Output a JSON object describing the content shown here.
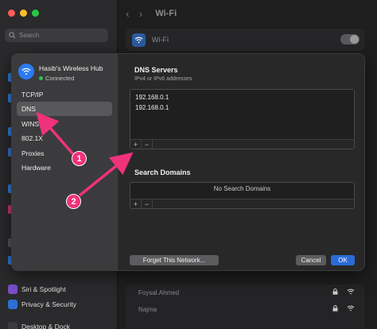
{
  "window": {
    "title": "Wi-Fi",
    "search_placeholder": "Search"
  },
  "sidebar": {
    "items": [
      {
        "label": "Siri & Spotlight",
        "icon": "siri-icon",
        "color": "#7a4ec9"
      },
      {
        "label": "Privacy & Security",
        "icon": "hand-icon",
        "color": "#2c6fd6"
      },
      {
        "label": "Desktop & Dock",
        "icon": "dock-icon",
        "color": "#3a3a3c"
      }
    ]
  },
  "wifi_card": {
    "label": "Wi-Fi"
  },
  "known_networks": [
    {
      "name": "Foysal.Ahmed"
    },
    {
      "name": "Najma"
    }
  ],
  "dialog": {
    "network_name": "Hasib's Wireless Hub",
    "network_status": "Connected",
    "nav_items": [
      {
        "label": "TCP/IP",
        "active": false
      },
      {
        "label": "DNS",
        "active": true
      },
      {
        "label": "WINS",
        "active": false
      },
      {
        "label": "802.1X",
        "active": false
      },
      {
        "label": "Proxies",
        "active": false
      },
      {
        "label": "Hardware",
        "active": false
      }
    ],
    "dns": {
      "title": "DNS Servers",
      "subtitle": "IPv4 or IPv6 addresses",
      "servers": [
        "192.168.0.1",
        "192.168.0.1"
      ],
      "add_label": "+",
      "remove_label": "−"
    },
    "search_domains": {
      "title": "Search Domains",
      "empty_text": "No Search Domains",
      "add_label": "+",
      "remove_label": "−"
    },
    "buttons": {
      "forget": "Forget This Network...",
      "cancel": "Cancel",
      "ok": "OK"
    }
  },
  "annotations": {
    "badge_1": "1",
    "badge_2": "2",
    "color": "#f0327a"
  }
}
